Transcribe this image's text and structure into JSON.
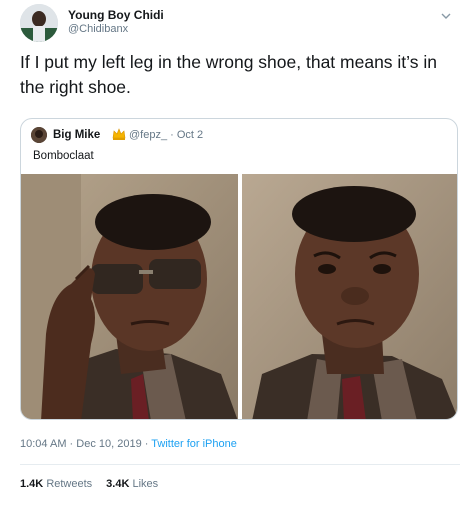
{
  "author": {
    "name": "Young Boy Chidi",
    "handle": "@Chidibanx"
  },
  "tweet": {
    "text": "If I put my left leg in the wrong shoe, that means it’s in the right shoe."
  },
  "quoted": {
    "name": "Big Mike",
    "handle_date": "@fepz_ · Oct 2",
    "text": "Bombo​claat",
    "media_icons": [
      "crown-emoji-icon"
    ]
  },
  "meta": {
    "timestamp": "10:04 AM · Dec 10, 2019 · ",
    "source": "Twitter for iPhone"
  },
  "stats": {
    "retweets_count": "1.4K",
    "retweets_label": "Retweets",
    "likes_count": "3.4K",
    "likes_label": "Likes"
  },
  "colors": {
    "link": "#1da1f2",
    "secondary_text": "#657786",
    "border": "#ccd6dd"
  }
}
